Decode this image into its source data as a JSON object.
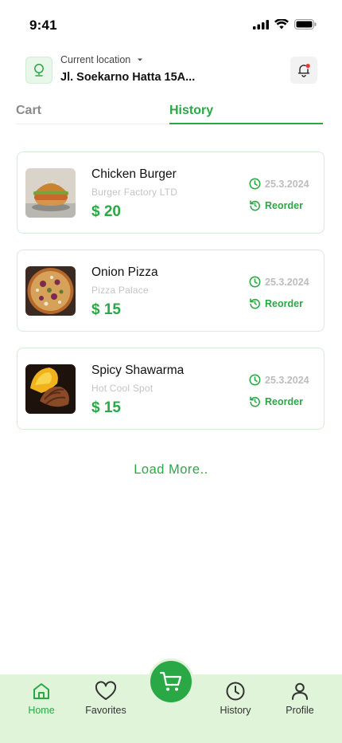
{
  "status_bar": {
    "time": "9:41"
  },
  "header": {
    "location_caption": "Current location",
    "location_address": "Jl. Soekarno Hatta 15A..."
  },
  "tabs": [
    {
      "label": "Cart",
      "active": false
    },
    {
      "label": "History",
      "active": true
    }
  ],
  "orders": [
    {
      "name": "Chicken Burger",
      "store": "Burger Factory LTD",
      "price": "$ 20",
      "date": "25.3.2024",
      "reorder_label": "Reorder"
    },
    {
      "name": "Onion Pizza",
      "store": "Pizza Palace",
      "price": "$ 15",
      "date": "25.3.2024",
      "reorder_label": "Reorder"
    },
    {
      "name": "Spicy Shawarma",
      "store": "Hot Cool Spot",
      "price": "$ 15",
      "date": "25.3.2024",
      "reorder_label": "Reorder"
    }
  ],
  "load_more": "Load More..",
  "bottom_nav": {
    "items": [
      {
        "label": "Home",
        "icon": "home-icon",
        "active": true
      },
      {
        "label": "Favorites",
        "icon": "heart-icon",
        "active": false
      },
      {
        "label": "History",
        "icon": "clock-icon",
        "active": false
      },
      {
        "label": "Profile",
        "icon": "user-icon",
        "active": false
      }
    ],
    "cart_icon": "cart-icon"
  },
  "colors": {
    "accent": "#2aa845",
    "nav_background": "#dff4d8",
    "card_border": "#d6ecd6",
    "notification_dot": "#e53935"
  }
}
